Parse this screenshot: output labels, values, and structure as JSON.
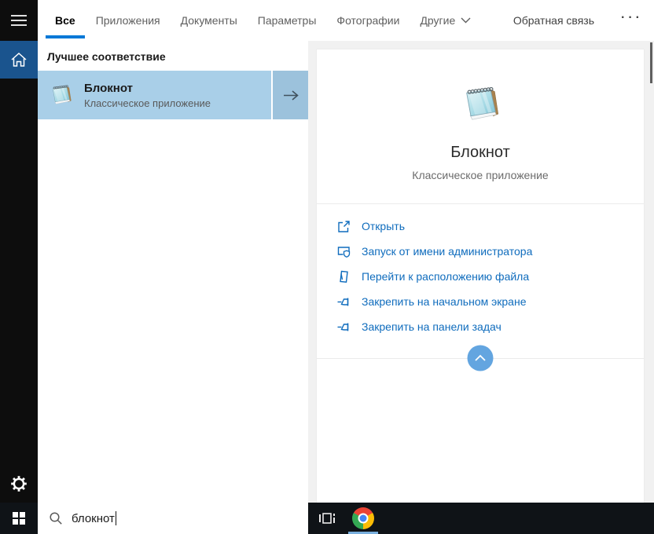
{
  "colors": {
    "accent": "#0078d7",
    "highlight": "#a9cfe8",
    "highlight_dark": "#9cc2dc",
    "link": "#0f6cbd",
    "rail_bg": "#0d0d0d",
    "taskbar_bg": "#0f1317",
    "home_bg": "#1a548e",
    "collapse_circle": "#63a5e0",
    "panel_bg": "#f1f1f1"
  },
  "tabbar": {
    "tabs": [
      {
        "label": "Все",
        "active": true
      },
      {
        "label": "Приложения",
        "active": false
      },
      {
        "label": "Документы",
        "active": false
      },
      {
        "label": "Параметры",
        "active": false
      },
      {
        "label": "Фотографии",
        "active": false
      },
      {
        "label": "Другие",
        "active": false,
        "has_dropdown": true
      }
    ],
    "feedback": "Обратная связь",
    "more": "···"
  },
  "results": {
    "section_header": "Лучшее соответствие",
    "best_match": {
      "title": "Блокнот",
      "subtitle": "Классическое приложение",
      "icon": "notepad-app-icon"
    }
  },
  "preview": {
    "title": "Блокнот",
    "subtitle": "Классическое приложение",
    "icon": "notepad-app-icon",
    "actions": [
      {
        "icon": "open-icon",
        "label": "Открыть"
      },
      {
        "icon": "run-as-admin-icon",
        "label": "Запуск от имени администратора"
      },
      {
        "icon": "file-location-icon",
        "label": "Перейти к расположению файла"
      },
      {
        "icon": "pin-to-start-icon",
        "label": "Закрепить на начальном экране"
      },
      {
        "icon": "pin-to-taskbar-icon",
        "label": "Закрепить на панели задач"
      }
    ]
  },
  "taskbar": {
    "search": {
      "value": "блокнот"
    }
  }
}
